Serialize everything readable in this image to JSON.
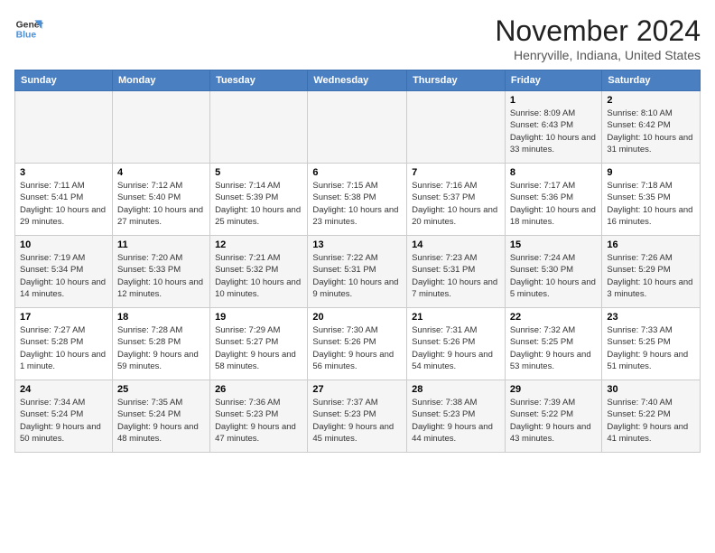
{
  "logo": {
    "line1": "General",
    "line2": "Blue",
    "icon_color": "#4a90d9"
  },
  "title": "November 2024",
  "location": "Henryville, Indiana, United States",
  "days_of_week": [
    "Sunday",
    "Monday",
    "Tuesday",
    "Wednesday",
    "Thursday",
    "Friday",
    "Saturday"
  ],
  "weeks": [
    [
      {
        "day": "",
        "info": ""
      },
      {
        "day": "",
        "info": ""
      },
      {
        "day": "",
        "info": ""
      },
      {
        "day": "",
        "info": ""
      },
      {
        "day": "",
        "info": ""
      },
      {
        "day": "1",
        "info": "Sunrise: 8:09 AM\nSunset: 6:43 PM\nDaylight: 10 hours and 33 minutes."
      },
      {
        "day": "2",
        "info": "Sunrise: 8:10 AM\nSunset: 6:42 PM\nDaylight: 10 hours and 31 minutes."
      }
    ],
    [
      {
        "day": "3",
        "info": "Sunrise: 7:11 AM\nSunset: 5:41 PM\nDaylight: 10 hours and 29 minutes."
      },
      {
        "day": "4",
        "info": "Sunrise: 7:12 AM\nSunset: 5:40 PM\nDaylight: 10 hours and 27 minutes."
      },
      {
        "day": "5",
        "info": "Sunrise: 7:14 AM\nSunset: 5:39 PM\nDaylight: 10 hours and 25 minutes."
      },
      {
        "day": "6",
        "info": "Sunrise: 7:15 AM\nSunset: 5:38 PM\nDaylight: 10 hours and 23 minutes."
      },
      {
        "day": "7",
        "info": "Sunrise: 7:16 AM\nSunset: 5:37 PM\nDaylight: 10 hours and 20 minutes."
      },
      {
        "day": "8",
        "info": "Sunrise: 7:17 AM\nSunset: 5:36 PM\nDaylight: 10 hours and 18 minutes."
      },
      {
        "day": "9",
        "info": "Sunrise: 7:18 AM\nSunset: 5:35 PM\nDaylight: 10 hours and 16 minutes."
      }
    ],
    [
      {
        "day": "10",
        "info": "Sunrise: 7:19 AM\nSunset: 5:34 PM\nDaylight: 10 hours and 14 minutes."
      },
      {
        "day": "11",
        "info": "Sunrise: 7:20 AM\nSunset: 5:33 PM\nDaylight: 10 hours and 12 minutes."
      },
      {
        "day": "12",
        "info": "Sunrise: 7:21 AM\nSunset: 5:32 PM\nDaylight: 10 hours and 10 minutes."
      },
      {
        "day": "13",
        "info": "Sunrise: 7:22 AM\nSunset: 5:31 PM\nDaylight: 10 hours and 9 minutes."
      },
      {
        "day": "14",
        "info": "Sunrise: 7:23 AM\nSunset: 5:31 PM\nDaylight: 10 hours and 7 minutes."
      },
      {
        "day": "15",
        "info": "Sunrise: 7:24 AM\nSunset: 5:30 PM\nDaylight: 10 hours and 5 minutes."
      },
      {
        "day": "16",
        "info": "Sunrise: 7:26 AM\nSunset: 5:29 PM\nDaylight: 10 hours and 3 minutes."
      }
    ],
    [
      {
        "day": "17",
        "info": "Sunrise: 7:27 AM\nSunset: 5:28 PM\nDaylight: 10 hours and 1 minute."
      },
      {
        "day": "18",
        "info": "Sunrise: 7:28 AM\nSunset: 5:28 PM\nDaylight: 9 hours and 59 minutes."
      },
      {
        "day": "19",
        "info": "Sunrise: 7:29 AM\nSunset: 5:27 PM\nDaylight: 9 hours and 58 minutes."
      },
      {
        "day": "20",
        "info": "Sunrise: 7:30 AM\nSunset: 5:26 PM\nDaylight: 9 hours and 56 minutes."
      },
      {
        "day": "21",
        "info": "Sunrise: 7:31 AM\nSunset: 5:26 PM\nDaylight: 9 hours and 54 minutes."
      },
      {
        "day": "22",
        "info": "Sunrise: 7:32 AM\nSunset: 5:25 PM\nDaylight: 9 hours and 53 minutes."
      },
      {
        "day": "23",
        "info": "Sunrise: 7:33 AM\nSunset: 5:25 PM\nDaylight: 9 hours and 51 minutes."
      }
    ],
    [
      {
        "day": "24",
        "info": "Sunrise: 7:34 AM\nSunset: 5:24 PM\nDaylight: 9 hours and 50 minutes."
      },
      {
        "day": "25",
        "info": "Sunrise: 7:35 AM\nSunset: 5:24 PM\nDaylight: 9 hours and 48 minutes."
      },
      {
        "day": "26",
        "info": "Sunrise: 7:36 AM\nSunset: 5:23 PM\nDaylight: 9 hours and 47 minutes."
      },
      {
        "day": "27",
        "info": "Sunrise: 7:37 AM\nSunset: 5:23 PM\nDaylight: 9 hours and 45 minutes."
      },
      {
        "day": "28",
        "info": "Sunrise: 7:38 AM\nSunset: 5:23 PM\nDaylight: 9 hours and 44 minutes."
      },
      {
        "day": "29",
        "info": "Sunrise: 7:39 AM\nSunset: 5:22 PM\nDaylight: 9 hours and 43 minutes."
      },
      {
        "day": "30",
        "info": "Sunrise: 7:40 AM\nSunset: 5:22 PM\nDaylight: 9 hours and 41 minutes."
      }
    ]
  ]
}
